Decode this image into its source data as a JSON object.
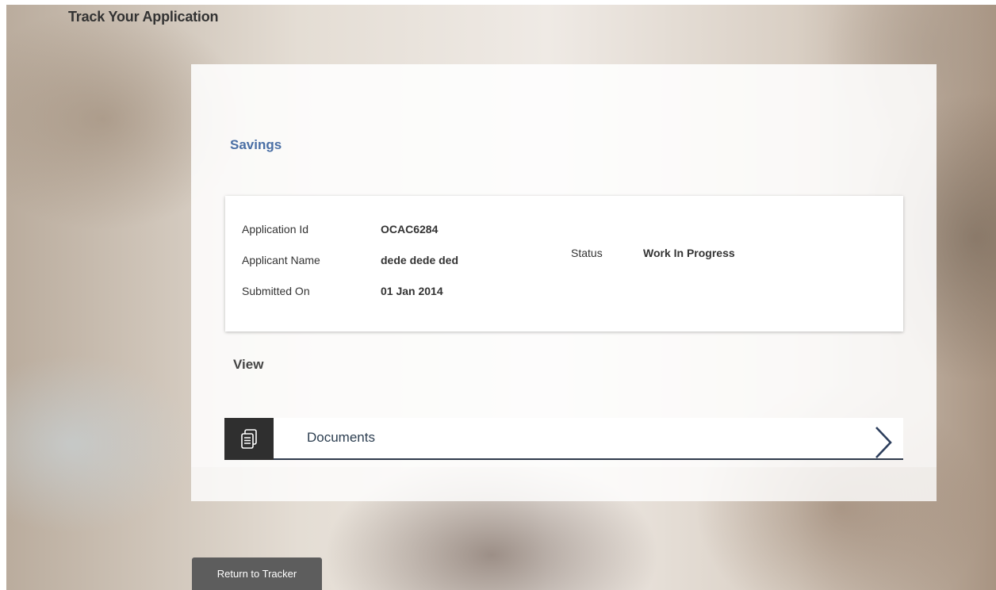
{
  "page": {
    "title": "Track Your Application"
  },
  "application": {
    "product": "Savings",
    "fields": {
      "id_label": "Application Id",
      "id_value": "OCAC6284",
      "name_label": "Applicant Name",
      "name_value": "dede dede ded",
      "submitted_label": "Submitted On",
      "submitted_value": "01 Jan 2014",
      "status_label": "Status",
      "status_value": "Work In Progress"
    }
  },
  "view": {
    "title": "View",
    "items": [
      {
        "label": "Documents",
        "icon": "documents-icon"
      }
    ]
  },
  "actions": {
    "return_label": "Return to Tracker"
  },
  "colors": {
    "accent": "#4a6fa5",
    "dark": "#2f2f2f",
    "button": "#5d5d5d"
  }
}
